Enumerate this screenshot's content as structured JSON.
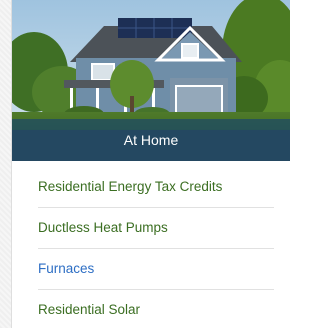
{
  "hero": {
    "caption": "At Home"
  },
  "menu": {
    "items": [
      {
        "label": "Residential Energy Tax Credits",
        "state": "normal"
      },
      {
        "label": "Ductless Heat Pumps",
        "state": "normal"
      },
      {
        "label": "Furnaces",
        "state": "hover"
      },
      {
        "label": "Residential Solar",
        "state": "normal"
      }
    ]
  },
  "colors": {
    "link": "#3b6e22",
    "link_hover": "#2d6ec4",
    "caption_bar": "#1c4868"
  }
}
